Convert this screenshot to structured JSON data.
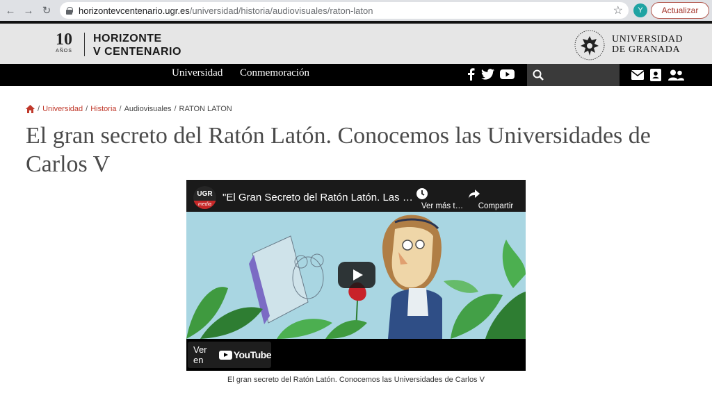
{
  "browser": {
    "url_host": "horizontevcentenario.ugr.es",
    "url_path": "/universidad/historia/audiovisuales/raton-laton",
    "profile_initial": "Y",
    "update_label": "Actualizar",
    "back_icon": "back-arrow-icon",
    "forward_icon": "forward-arrow-icon",
    "reload_icon": "reload-icon"
  },
  "header": {
    "logo_number": "10",
    "logo_years": "AÑOS",
    "logo_line1": "HORIZONTE",
    "logo_line2": "V CENTENARIO",
    "ugr_line1": "UNIVERSIDAD",
    "ugr_line2": "DE GRANADA"
  },
  "nav": {
    "items": [
      {
        "label": "Universidad"
      },
      {
        "label": "Conmemoración"
      }
    ]
  },
  "breadcrumb": {
    "items": [
      {
        "label": "Universidad"
      },
      {
        "label": "Historia"
      },
      {
        "label": "Audiovisuales"
      },
      {
        "label": "RATON LATON"
      }
    ]
  },
  "page": {
    "title": "El gran secreto del Ratón Latón. Conocemos las Universidades de Carlos V"
  },
  "video": {
    "channel_top": "UGR",
    "channel_bottom": "media",
    "title": "\"El Gran Secreto del Ratón Latón. Las Universidades de Carlos V\"",
    "watch_later": "Ver más tarde",
    "share": "Compartir",
    "watch_on": "Ver en",
    "youtube": "YouTube"
  },
  "caption": "El gran secreto del Ratón Latón. Conocemos las Universidades de Carlos V",
  "colors": {
    "accent": "#c0392b",
    "nav_bg": "#000000",
    "header_bg": "#e6e6e6"
  }
}
